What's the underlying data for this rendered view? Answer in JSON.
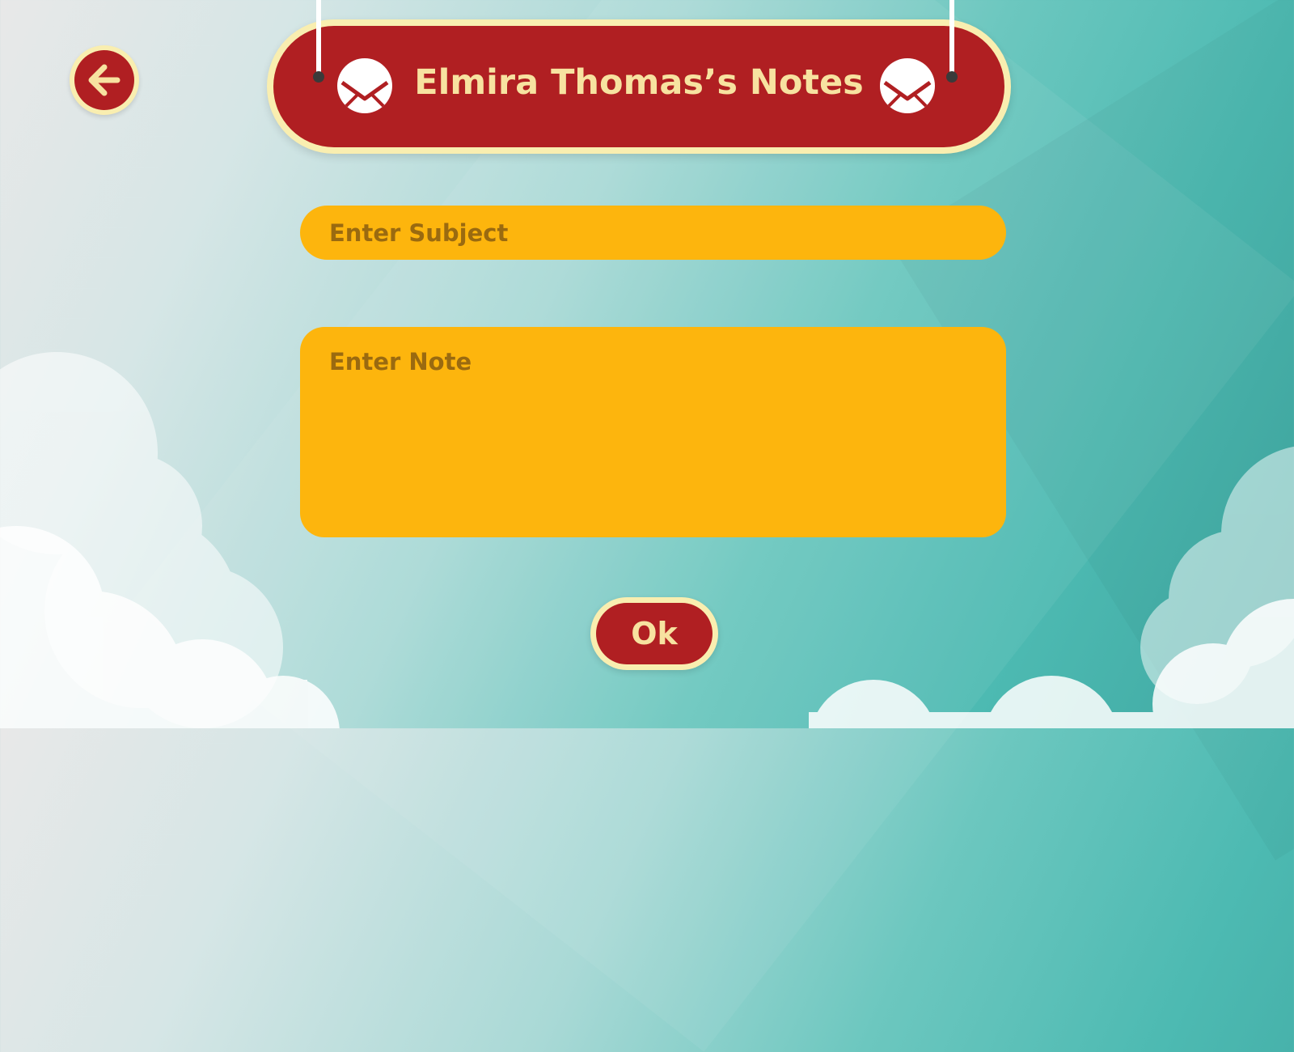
{
  "header": {
    "title": "Elmira Thomas’s Notes",
    "back_icon": "arrow-left-icon",
    "decor_icons": [
      "envelope-icon",
      "envelope-icon"
    ]
  },
  "form": {
    "subject_placeholder": "Enter Subject",
    "subject_value": "",
    "note_placeholder": "Enter Note",
    "note_value": ""
  },
  "actions": {
    "ok_label": "Ok"
  },
  "colors": {
    "primary_red": "#b01f22",
    "cream": "#f9eeb0",
    "title_text": "#f7e2a0",
    "field_yellow": "#fdb50d",
    "placeholder_text": "#9a6a10",
    "teal": "#4dbab2"
  }
}
